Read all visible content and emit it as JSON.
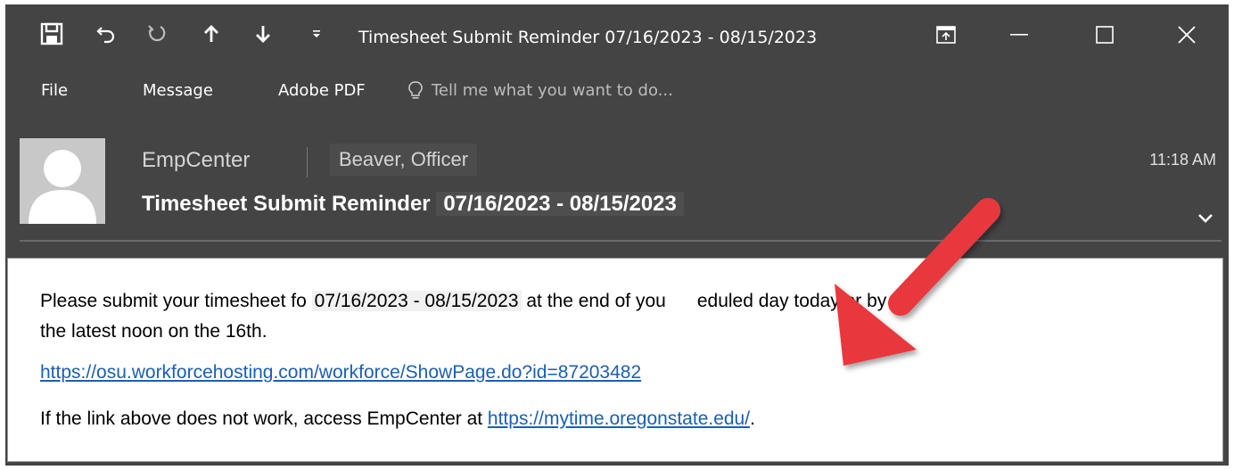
{
  "window": {
    "title": "Timesheet Submit Reminder 07/16/2023 - 08/15/2023",
    "quick_access": [
      {
        "icon": "save-icon"
      },
      {
        "icon": "undo-icon"
      },
      {
        "icon": "redo-icon"
      },
      {
        "icon": "previous-item-icon"
      },
      {
        "icon": "next-item-icon"
      },
      {
        "icon": "customize-toolbar-icon"
      }
    ],
    "controls": [
      "ribbon-display-options-icon",
      "minimize-icon",
      "maximize-icon",
      "close-icon"
    ]
  },
  "ribbon": {
    "tabs": [
      "File",
      "Message",
      "Adobe PDF"
    ],
    "tell_me": "Tell me what you want to do..."
  },
  "message": {
    "from": "EmpCenter",
    "to": "Beaver, Officer",
    "subject_prefix": "Timesheet Submit Reminder",
    "subject_dates": "07/16/2023 - 08/15/2023",
    "time": "11:18 AM"
  },
  "body": {
    "line1_pre": "Please submit your timesheet fo",
    "line1_dates": "07/16/2023 - 08/15/2023",
    "line1_post": "at the end of you      eduled day today or by",
    "line2": "the latest noon on the 16th.",
    "link1": "https://osu.workforcehosting.com/workforce/ShowPage.do?id=87203482",
    "line4_pre": "If the link above does not work, access EmpCenter at ",
    "link2": "https://mytime.oregonstate.edu/",
    "line4_post": "."
  },
  "colors": {
    "chrome": "#444444",
    "link": "#1a5fb4",
    "arrow": "#e8393d"
  }
}
